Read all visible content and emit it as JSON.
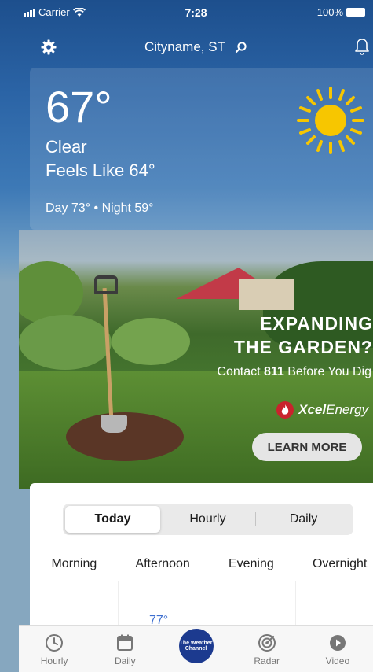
{
  "status_bar": {
    "carrier": "Carrier",
    "time": "7:28",
    "battery": "100%"
  },
  "header": {
    "location": "Cityname, ST"
  },
  "current": {
    "temperature": "67°",
    "phrase": "Clear",
    "feels_like": "Feels Like 64°",
    "day_night": "Day 73° • Night 59°",
    "icon": "sun-icon"
  },
  "ad": {
    "headline_line1": "EXPANDING",
    "headline_line2": "THE GARDEN?",
    "sub_prefix": "Contact ",
    "sub_bold": "811",
    "sub_suffix": " Before You Dig",
    "brand_bold": "Xcel",
    "brand_rest": "Energy",
    "cta": "LEARN MORE"
  },
  "forecast": {
    "tabs": [
      "Today",
      "Hourly",
      "Daily"
    ],
    "active_tab": "Today",
    "periods": [
      "Morning",
      "Afternoon",
      "Evening",
      "Overnight"
    ],
    "visible_temp": "77°"
  },
  "tabbar": {
    "items": [
      {
        "label": "Hourly",
        "icon": "clock-icon"
      },
      {
        "label": "Daily",
        "icon": "calendar-icon"
      },
      {
        "label": "The Weather Channel",
        "icon": "twc-logo"
      },
      {
        "label": "Radar",
        "icon": "radar-icon"
      },
      {
        "label": "Video",
        "icon": "play-icon"
      }
    ]
  },
  "colors": {
    "sky_top": "#1d4f8d",
    "accent_blue": "#3d6fd0",
    "twc_blue": "#1c3a8f",
    "sun_yellow": "#f7c600",
    "xcel_red": "#c9232d"
  }
}
